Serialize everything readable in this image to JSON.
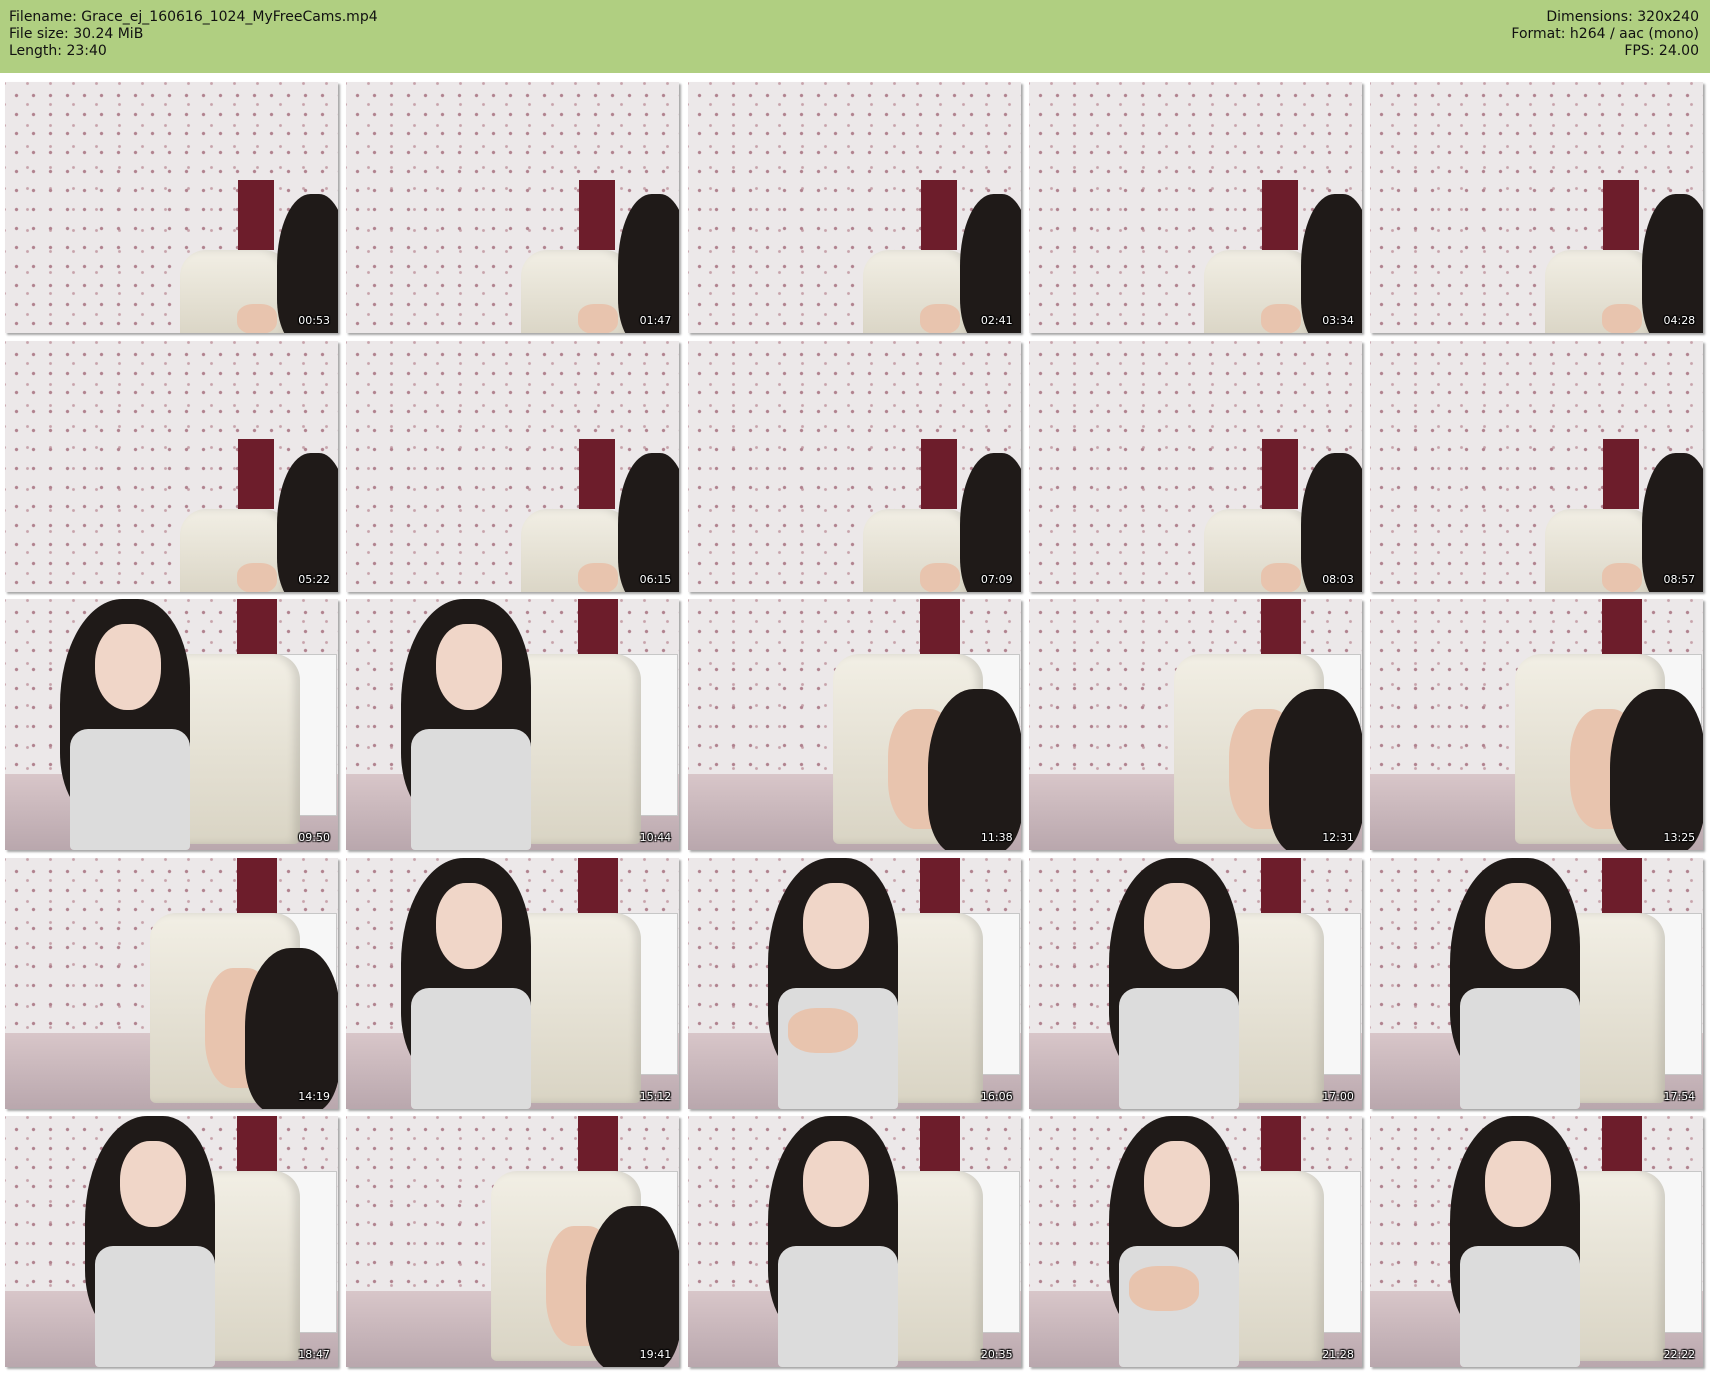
{
  "header": {
    "filename": "Filename: Grace_ej_160616_1024_MyFreeCams.mp4",
    "filesize": "File size: 30.24 MiB",
    "length": "Length: 23:40",
    "dimensions": "Dimensions: 320x240",
    "format": "Format: h264 / aac (mono)",
    "fps": "FPS: 24.00",
    "background_color": "#b0cf81"
  },
  "thumbnails": [
    {
      "time": "00:53",
      "scene": "empty"
    },
    {
      "time": "01:47",
      "scene": "empty"
    },
    {
      "time": "02:41",
      "scene": "empty"
    },
    {
      "time": "03:34",
      "scene": "empty"
    },
    {
      "time": "04:28",
      "scene": "empty"
    },
    {
      "time": "05:22",
      "scene": "empty"
    },
    {
      "time": "06:15",
      "scene": "empty"
    },
    {
      "time": "07:09",
      "scene": "empty"
    },
    {
      "time": "08:03",
      "scene": "empty"
    },
    {
      "time": "08:57",
      "scene": "empty"
    },
    {
      "time": "09:50",
      "scene": "person-close"
    },
    {
      "time": "10:44",
      "scene": "person-close"
    },
    {
      "time": "11:38",
      "scene": "person-side"
    },
    {
      "time": "12:31",
      "scene": "person-side"
    },
    {
      "time": "13:25",
      "scene": "person-side"
    },
    {
      "time": "14:19",
      "scene": "person-side"
    },
    {
      "time": "15:12",
      "scene": "person-close"
    },
    {
      "time": "16:06",
      "scene": "person-phone"
    },
    {
      "time": "17:00",
      "scene": "person-center"
    },
    {
      "time": "17:54",
      "scene": "person-center"
    },
    {
      "time": "18:47",
      "scene": "person-center"
    },
    {
      "time": "19:41",
      "scene": "person-side"
    },
    {
      "time": "20:35",
      "scene": "person-center"
    },
    {
      "time": "21:28",
      "scene": "person-phone"
    },
    {
      "time": "22:22",
      "scene": "person-center"
    }
  ]
}
